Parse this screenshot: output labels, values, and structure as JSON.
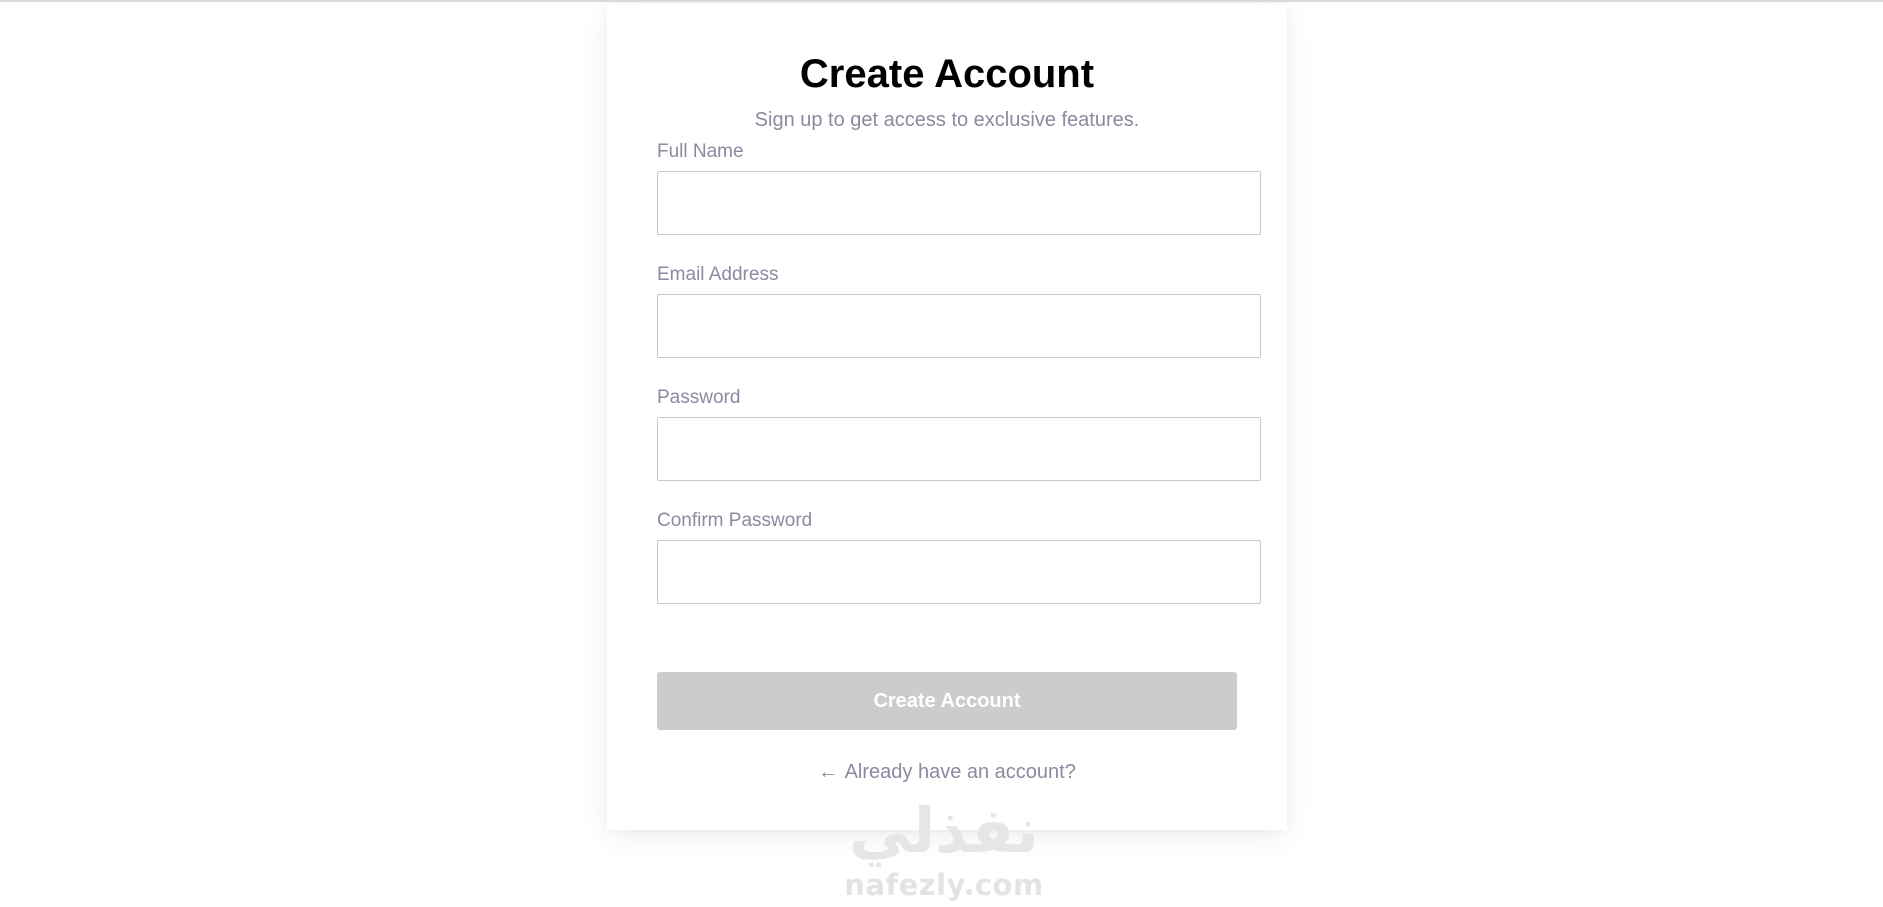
{
  "form": {
    "title": "Create Account",
    "subtitle": "Sign up to get access to exclusive features.",
    "fields": [
      {
        "label": "Full Name",
        "value": "",
        "placeholder": ""
      },
      {
        "label": "Email Address",
        "value": "",
        "placeholder": ""
      },
      {
        "label": "Password",
        "value": "",
        "placeholder": ""
      },
      {
        "label": "Confirm Password",
        "value": "",
        "placeholder": ""
      }
    ],
    "submit_label": "Create Account",
    "submit_state": "disabled",
    "login_arrow": "←",
    "login_link": "Already have an account?"
  },
  "watermark": {
    "arabic": "نفذلي",
    "latin": "nafezly.com"
  },
  "colors": {
    "page_background": "#ffffff",
    "title": "#000000",
    "muted_text": "#8a8aa0",
    "input_border": "#c8c8cc",
    "button_disabled": "#cccccc",
    "button_text": "#ffffff",
    "watermark": "#e3e3e3"
  }
}
